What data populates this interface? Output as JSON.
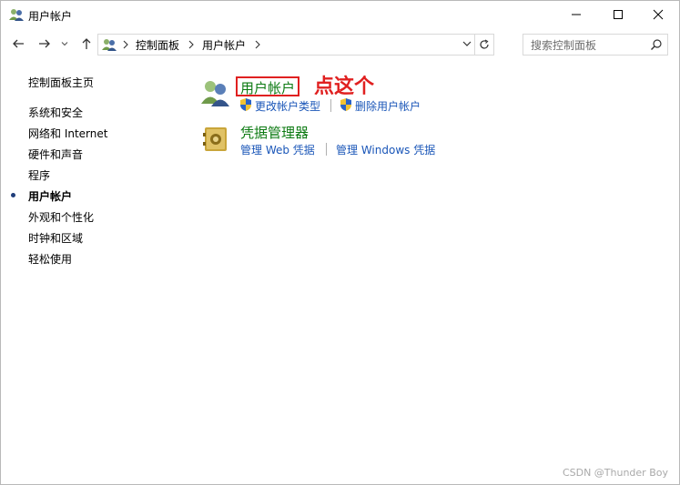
{
  "window": {
    "title": "用户帐户"
  },
  "address_bar": {
    "crumbs": [
      "控制面板",
      "用户帐户"
    ]
  },
  "search": {
    "placeholder": "搜索控制面板"
  },
  "left_nav": {
    "items": [
      {
        "label": "控制面板主页",
        "active": false
      },
      {
        "label": "系统和安全",
        "active": false
      },
      {
        "label": "网络和 Internet",
        "active": false
      },
      {
        "label": "硬件和声音",
        "active": false
      },
      {
        "label": "程序",
        "active": false
      },
      {
        "label": "用户帐户",
        "active": true
      },
      {
        "label": "外观和个性化",
        "active": false
      },
      {
        "label": "时钟和区域",
        "active": false
      },
      {
        "label": "轻松使用",
        "active": false
      }
    ]
  },
  "main": {
    "user_accounts": {
      "title": "用户帐户",
      "links": [
        "更改帐户类型",
        "删除用户帐户"
      ]
    },
    "credential_manager": {
      "title": "凭据管理器",
      "links": [
        "管理 Web 凭据",
        "管理 Windows 凭据"
      ]
    },
    "annotation": "点这个"
  },
  "watermark": "CSDN @Thunder Boy",
  "colors": {
    "link": "#1a56b8",
    "category_title": "#0c7a12",
    "highlight": "#e02020"
  }
}
